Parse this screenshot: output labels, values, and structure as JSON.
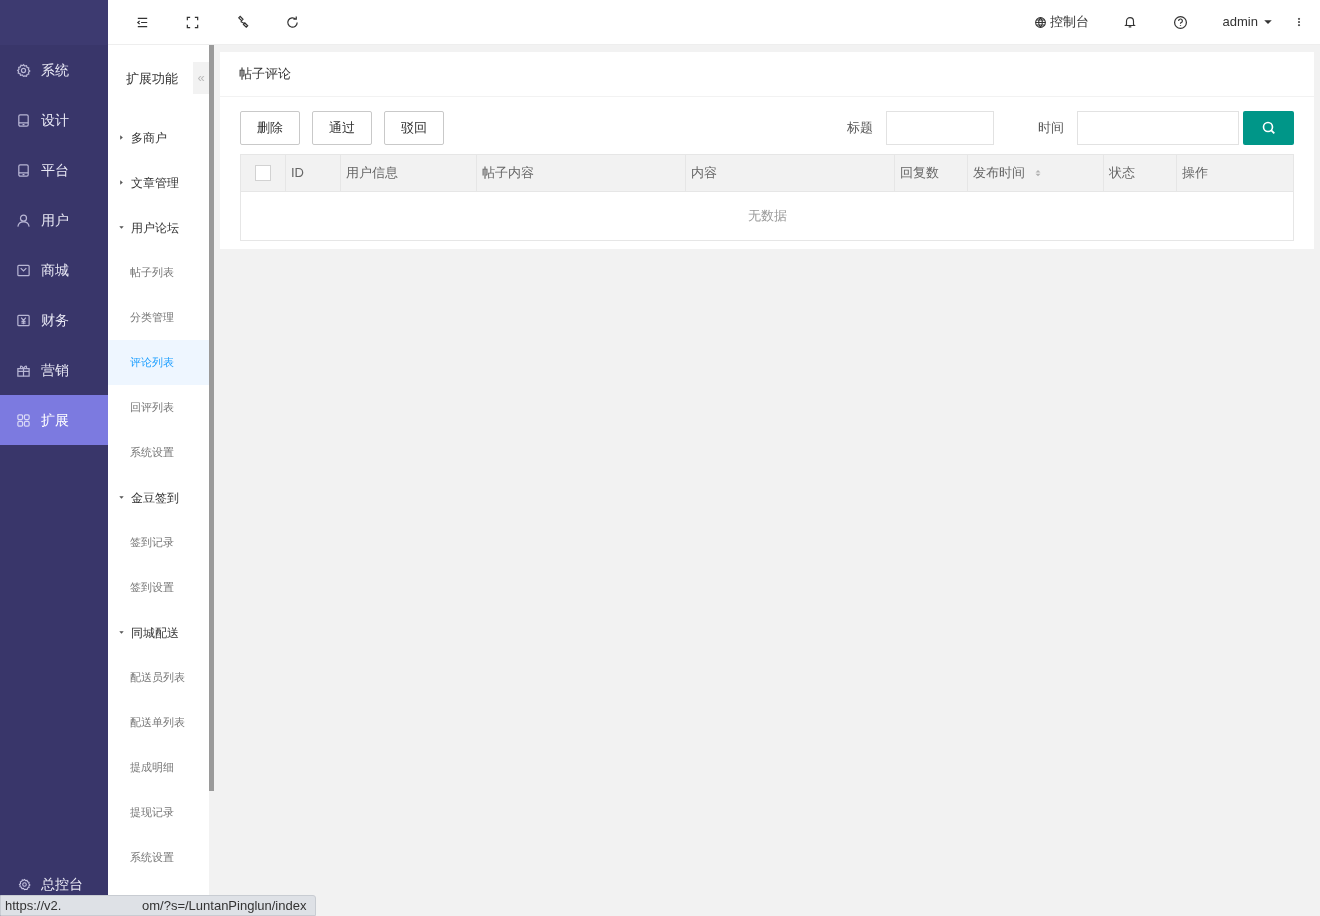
{
  "sidebar": {
    "items": [
      {
        "label": "系统",
        "selected": false
      },
      {
        "label": "设计",
        "selected": false
      },
      {
        "label": "平台",
        "selected": false
      },
      {
        "label": "用户",
        "selected": false
      },
      {
        "label": "商城",
        "selected": false
      },
      {
        "label": "财务",
        "selected": false
      },
      {
        "label": "营销",
        "selected": false
      },
      {
        "label": "扩展",
        "selected": true
      }
    ],
    "footer": "总控台"
  },
  "submenu": {
    "title": "扩展功能",
    "collapse": "«",
    "groups": [
      {
        "label": "多商户",
        "expanded": false
      },
      {
        "label": "文章管理",
        "expanded": false
      },
      {
        "label": "用户论坛",
        "expanded": true,
        "children": [
          {
            "label": "帖子列表",
            "selected": false
          },
          {
            "label": "分类管理",
            "selected": false
          },
          {
            "label": "评论列表",
            "selected": true
          },
          {
            "label": "回评列表",
            "selected": false
          },
          {
            "label": "系统设置",
            "selected": false
          }
        ]
      },
      {
        "label": "金豆签到",
        "expanded": true,
        "children": [
          {
            "label": "签到记录",
            "selected": false
          },
          {
            "label": "签到设置",
            "selected": false
          }
        ]
      },
      {
        "label": "同城配送",
        "expanded": true,
        "children": [
          {
            "label": "配送员列表",
            "selected": false
          },
          {
            "label": "配送单列表",
            "selected": false
          },
          {
            "label": "提成明细",
            "selected": false
          },
          {
            "label": "提现记录",
            "selected": false
          },
          {
            "label": "系统设置",
            "selected": false
          }
        ]
      }
    ]
  },
  "topbar": {
    "console": "控制台",
    "user": "admin"
  },
  "card": {
    "title": "帖子评论",
    "buttons": [
      "删除",
      "通过",
      "驳回"
    ],
    "filters": [
      {
        "label": "标题"
      },
      {
        "label": "时间"
      }
    ],
    "table": {
      "columns": [
        {
          "label": "ID",
          "sortable": false
        },
        {
          "label": "用户信息",
          "sortable": false
        },
        {
          "label": "帖子内容",
          "sortable": false
        },
        {
          "label": "内容",
          "sortable": false
        },
        {
          "label": "回复数",
          "sortable": false
        },
        {
          "label": "发布时间",
          "sortable": true
        },
        {
          "label": "状态",
          "sortable": false
        },
        {
          "label": "操作",
          "sortable": false
        }
      ],
      "all_checked": false,
      "empty": "无数据"
    }
  },
  "status_bar": {
    "url_start": "https://v2.",
    "url_end": "om/?s=/LuntanPinglun/index"
  }
}
